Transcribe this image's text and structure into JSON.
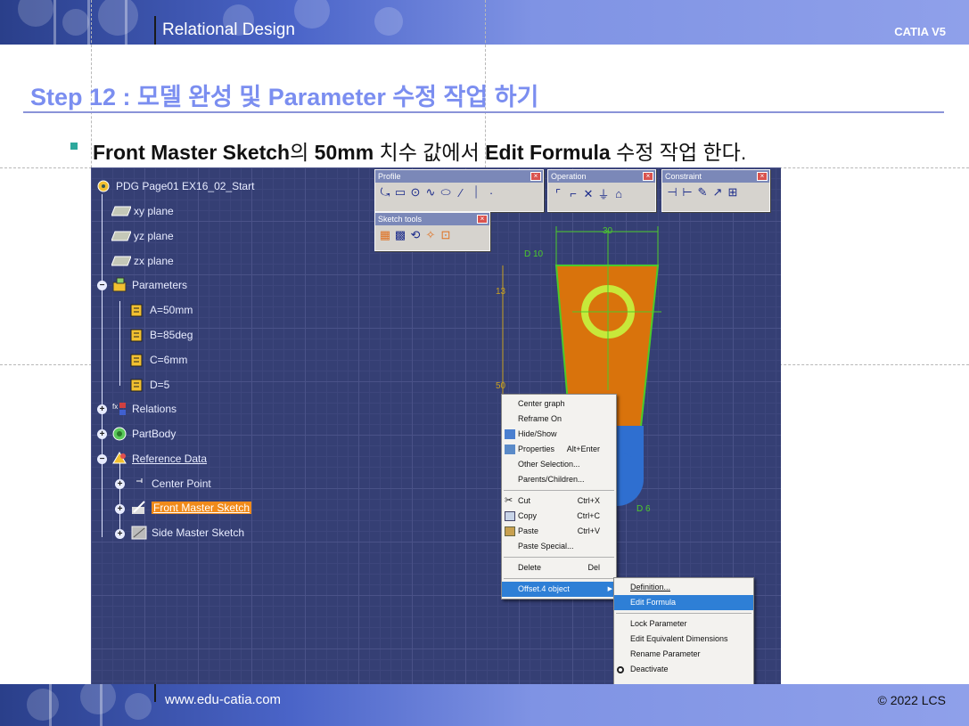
{
  "header": {
    "title": "Relational Design",
    "product": "CATIA V5"
  },
  "footer": {
    "url": "www.edu-catia.com",
    "copyright": "© 2022 LCS"
  },
  "step": {
    "title": "Step 12 : 모델 완성 및 Parameter 수정 작업 하기"
  },
  "bullet": {
    "part1": "Front Master Sketch",
    "part2": "의 ",
    "part3": "50mm",
    "part4": " 치수 값에서 ",
    "part5": "Edit Formula",
    "part6": " 수정 작업 한다."
  },
  "tree": {
    "root": "PDG Page01 EX16_02_Start",
    "planes": [
      "xy plane",
      "yz plane",
      "zx plane"
    ],
    "parameters": "Parameters",
    "params": [
      "A=50mm",
      "B=85deg",
      "C=6mm",
      "D=5"
    ],
    "relations": "Relations",
    "partbody": "PartBody",
    "reference": "Reference Data",
    "center_point": "Center Point",
    "front_sketch": "Front Master Sketch",
    "side_sketch": "Side Master Sketch"
  },
  "toolbars": {
    "profile": "Profile",
    "operation": "Operation",
    "constraint": "Constraint",
    "sketch_tools": "Sketch tools"
  },
  "sketch_labels": {
    "d30": "30",
    "d10": "D 10",
    "d13": "13",
    "d50": "50",
    "d6": "D 6"
  },
  "context_menu": {
    "items": [
      {
        "label": "Center graph",
        "shortcut": ""
      },
      {
        "label": "Reframe On",
        "shortcut": ""
      },
      {
        "label": "Hide/Show",
        "shortcut": ""
      },
      {
        "label": "Properties",
        "shortcut": "Alt+Enter"
      },
      {
        "label": "Other Selection...",
        "shortcut": ""
      },
      {
        "label": "Parents/Children...",
        "shortcut": ""
      },
      {
        "label": "Cut",
        "shortcut": "Ctrl+X"
      },
      {
        "label": "Copy",
        "shortcut": "Ctrl+C"
      },
      {
        "label": "Paste",
        "shortcut": "Ctrl+V"
      },
      {
        "label": "Paste Special...",
        "shortcut": ""
      },
      {
        "label": "Delete",
        "shortcut": "Del"
      },
      {
        "label": "Offset.4 object",
        "shortcut": ""
      }
    ]
  },
  "submenu": {
    "items": [
      "Definition...",
      "Edit Formula",
      "Lock Parameter",
      "Edit Equivalent Dimensions",
      "Rename Parameter",
      "Deactivate"
    ]
  },
  "colors": {
    "title_blue": "#7b8ef0",
    "sketch_orange": "#d9730c",
    "sketch_green": "#4ccb2a",
    "highlight": "#f08a1a",
    "menu_select": "#2e7fd6"
  }
}
